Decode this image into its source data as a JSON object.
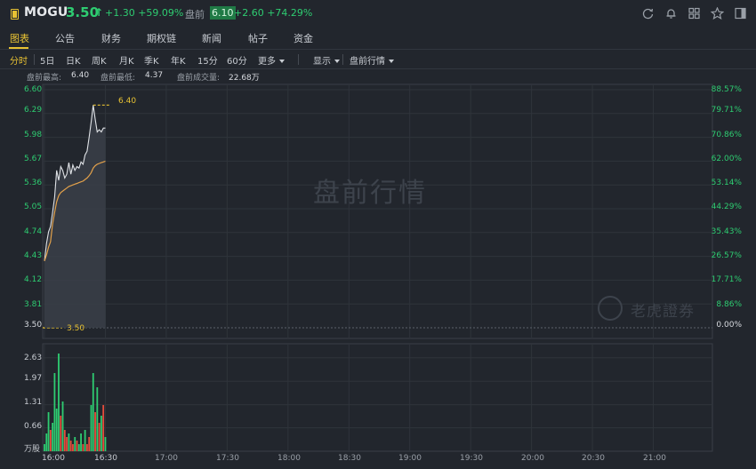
{
  "header": {
    "symbol": "MOGU",
    "last_price": "3.50",
    "arrow": "↑",
    "change": "+1.30 +59.09%",
    "premarket_label": "盘前",
    "premarket_price": "6.10",
    "premarket_change": "+2.60 +74.29%",
    "icons": [
      "refresh-icon",
      "bell-icon",
      "grid-icon",
      "star-icon",
      "panel-icon"
    ]
  },
  "tabs": [
    "图表",
    "公告",
    "财务",
    "期权链",
    "新闻",
    "帖子",
    "资金"
  ],
  "active_tab": "图表",
  "periods": {
    "items": [
      "分时",
      "5日",
      "日K",
      "周K",
      "月K",
      "季K",
      "年K",
      "15分",
      "60分"
    ],
    "more_label": "更多",
    "display_label": "显示",
    "premarket_label": "盘前行情",
    "active": "分时"
  },
  "stats": {
    "high_label": "盘前最高:",
    "high_value": "6.40",
    "low_label": "盘前最低:",
    "low_value": "4.37",
    "volume_label": "盘前成交量:",
    "volume_value": "22.68万"
  },
  "watermark": {
    "main": "盘前行情",
    "brand": "老虎證券"
  },
  "colors": {
    "up": "#2ecc71",
    "down": "#e74c3c",
    "accent": "#e8c233",
    "avg_line": "#e2a14b",
    "price_line": "#dfe2e6"
  },
  "chart_data": {
    "type": "line",
    "y_price_ticks": [
      "6.60",
      "6.29",
      "5.98",
      "5.67",
      "5.36",
      "5.05",
      "4.74",
      "4.43",
      "4.12",
      "3.81",
      "3.50"
    ],
    "y_pct_ticks": [
      "88.57%",
      "79.71%",
      "70.86%",
      "62.00%",
      "53.14%",
      "44.29%",
      "35.43%",
      "26.57%",
      "17.71%",
      "8.86%",
      "0.00%"
    ],
    "ylim": [
      3.5,
      6.6
    ],
    "prev_close": 3.5,
    "prev_close_label": "3.50",
    "high_marker_label": "6.40",
    "x_ticks": [
      "16:00",
      "16:30",
      "17:00",
      "17:30",
      "18:00",
      "18:30",
      "19:00",
      "19:30",
      "20:00",
      "20:30",
      "21:00"
    ],
    "x_range_minutes": [
      0,
      330
    ],
    "series": [
      {
        "minutes": [
          0,
          1,
          2,
          3,
          4,
          5,
          6,
          7,
          8,
          9,
          10,
          11,
          12,
          13,
          14,
          15,
          16,
          17,
          18,
          19,
          20,
          21,
          22,
          23,
          24,
          25,
          26,
          27,
          28,
          29,
          30
        ],
        "values": [
          4.37,
          4.6,
          4.75,
          4.82,
          5.0,
          5.2,
          5.55,
          5.42,
          5.6,
          5.55,
          5.45,
          5.5,
          5.65,
          5.5,
          5.62,
          5.55,
          5.6,
          5.58,
          5.66,
          5.63,
          5.75,
          5.8,
          5.98,
          6.18,
          6.4,
          6.22,
          6.05,
          6.08,
          6.05,
          6.1,
          6.1
        ]
      },
      {
        "minutes": [
          0,
          1,
          2,
          3,
          4,
          5,
          6,
          7,
          8,
          9,
          10,
          11,
          12,
          13,
          14,
          15,
          16,
          17,
          18,
          19,
          20,
          21,
          22,
          23,
          24,
          25,
          26,
          27,
          28,
          29,
          30
        ],
        "values": [
          4.37,
          4.45,
          4.55,
          4.62,
          4.85,
          5.0,
          5.14,
          5.22,
          5.26,
          5.28,
          5.3,
          5.32,
          5.34,
          5.35,
          5.36,
          5.37,
          5.38,
          5.39,
          5.4,
          5.41,
          5.43,
          5.45,
          5.48,
          5.52,
          5.58,
          5.61,
          5.63,
          5.64,
          5.65,
          5.66,
          5.67
        ]
      }
    ],
    "volume": {
      "unit_label": "万股",
      "y_ticks": [
        "2.63",
        "1.97",
        "1.31",
        "0.66"
      ],
      "ylim": [
        0,
        2.9
      ],
      "values": [
        0.2,
        0.5,
        1.1,
        0.6,
        0.8,
        2.2,
        1.2,
        2.75,
        1.0,
        1.4,
        0.6,
        0.4,
        0.5,
        0.3,
        0.2,
        0.4,
        0.3,
        0.2,
        0.5,
        0.2,
        0.6,
        0.2,
        0.4,
        1.3,
        2.2,
        1.1,
        1.8,
        0.8,
        1.0,
        1.3,
        0.4
      ],
      "up": [
        1,
        1,
        1,
        0,
        1,
        1,
        1,
        1,
        0,
        1,
        0,
        0,
        1,
        0,
        0,
        1,
        0,
        1,
        1,
        0,
        1,
        0,
        0,
        1,
        1,
        0,
        1,
        0,
        1,
        0,
        1
      ]
    }
  }
}
